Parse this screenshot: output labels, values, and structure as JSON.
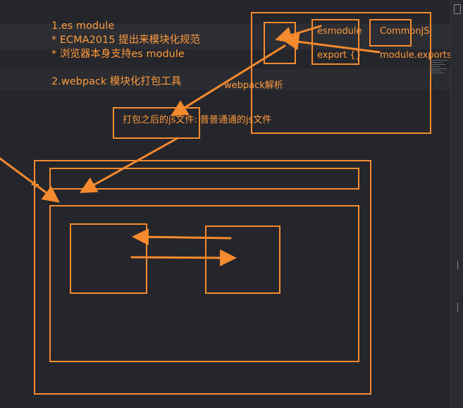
{
  "notes": {
    "line1": "1.es module",
    "line2": "* ECMA2015 提出来模块化规范",
    "line3": "* 浏览器本身支持es module",
    "line4": "2.webpack 模块化打包工具"
  },
  "diagram": {
    "esmodule_label": "esmodule",
    "commonjs_label": "CommonJS",
    "export_label": "export {}",
    "module_exports_label": "module.exports =",
    "webpack_parse_label": "webpack解析",
    "bundled_file_label": "打包之后的js文件: 普普通通的js文件"
  },
  "colors": {
    "ink": "#ff9a3c",
    "stroke": "#f58a2e",
    "background": "#25262b"
  },
  "icons": {
    "top_right": "window-icon",
    "cursor": "crosshair-cursor-icon"
  }
}
